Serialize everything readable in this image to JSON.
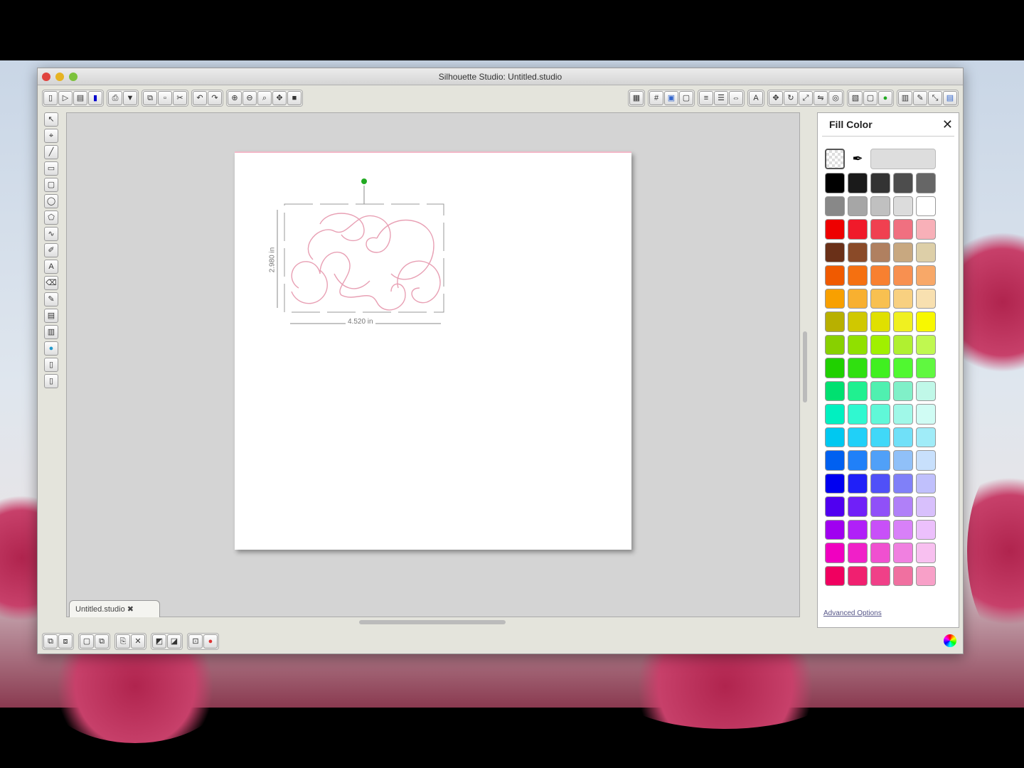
{
  "window": {
    "title": "Silhouette Studio: Untitled.studio"
  },
  "document_tab": {
    "label": "Untitled.studio",
    "close": "✖"
  },
  "selection": {
    "width_label": "4.520 in",
    "height_label": "2.980 in"
  },
  "fill_panel": {
    "title": "Fill Color",
    "close": "✕",
    "advanced": "Advanced Options",
    "colors": [
      "#000000",
      "#1a1a1a",
      "#333333",
      "#4d4d4d",
      "#666666",
      "#888888",
      "#a6a6a6",
      "#c0c0c0",
      "#dcdcdc",
      "#ffffff",
      "#ee0000",
      "#f01a2a",
      "#f04050",
      "#f07080",
      "#f8b0b8",
      "#6a3018",
      "#8a4a28",
      "#b08060",
      "#c8a880",
      "#ddcfa8",
      "#f05a00",
      "#f57010",
      "#f88030",
      "#f89050",
      "#f8a868",
      "#f8a000",
      "#f8b030",
      "#f8c050",
      "#f8d080",
      "#f8e0b0",
      "#b8b000",
      "#d0c800",
      "#e0e000",
      "#f0f020",
      "#f8f800",
      "#88d000",
      "#90e000",
      "#a0f000",
      "#b0f030",
      "#c0f850",
      "#20d000",
      "#30e010",
      "#40f020",
      "#50f830",
      "#60f840",
      "#00e070",
      "#20f090",
      "#50f0b0",
      "#80f0c8",
      "#c0f8e8",
      "#00f0c0",
      "#30f8d0",
      "#60f8d8",
      "#a0f8e8",
      "#d0fcf4",
      "#00c8f0",
      "#20d0f8",
      "#40d8f8",
      "#70e0f8",
      "#a0ecf8",
      "#0060f0",
      "#2080f8",
      "#50a0f8",
      "#90c0f8",
      "#c8e0fc",
      "#0000f0",
      "#2020f8",
      "#5050f8",
      "#8080f8",
      "#c0c0fc",
      "#5000f0",
      "#7020f8",
      "#9050f8",
      "#b080f8",
      "#d8c0fc",
      "#a000f0",
      "#b020f8",
      "#c850f8",
      "#d880f8",
      "#ecc0fc",
      "#f000c0",
      "#f020c8",
      "#f050d0",
      "#f080e0",
      "#f8c0f0",
      "#f00060",
      "#f02070",
      "#f04088",
      "#f070a0",
      "#f8a0c8"
    ]
  }
}
